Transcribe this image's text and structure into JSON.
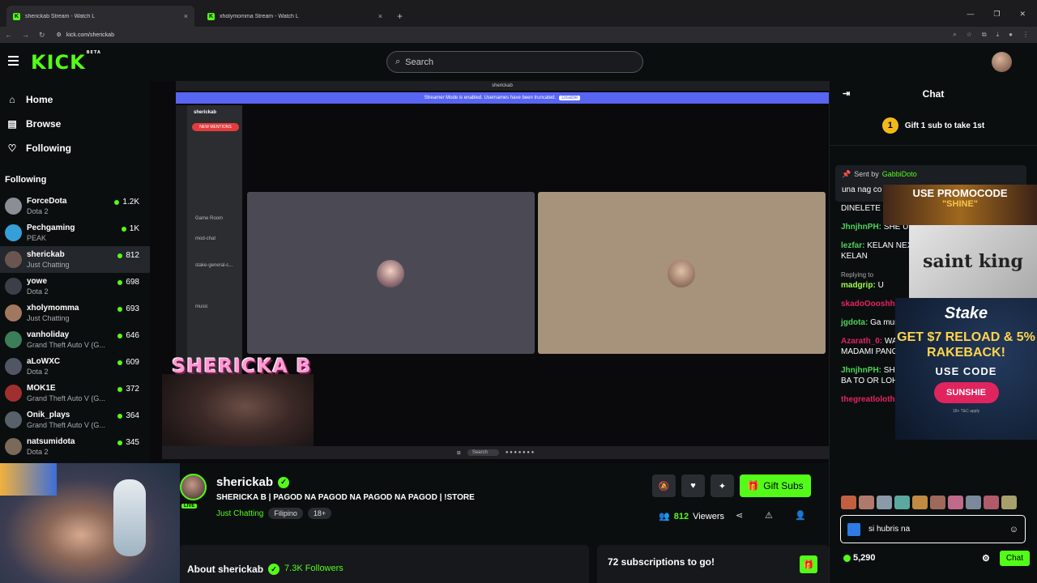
{
  "browser": {
    "tabs": [
      {
        "title": "sherickab Stream - Watch L",
        "active": true
      },
      {
        "title": "xholymomma Stream - Watch L",
        "active": false
      }
    ],
    "new_tab": "+",
    "url": "kick.com/sherickab"
  },
  "header": {
    "logo": "KICK",
    "logo_badge": "BETA",
    "search_placeholder": "Search"
  },
  "sidebar": {
    "nav": [
      {
        "label": "Home",
        "icon": "home-icon"
      },
      {
        "label": "Browse",
        "icon": "browse-icon"
      },
      {
        "label": "Following",
        "icon": "heart-icon"
      }
    ],
    "following_heading": "Following",
    "channels": [
      {
        "name": "ForceDota",
        "game": "Dota 2",
        "viewers": "1.2K",
        "color": "#8a8f96"
      },
      {
        "name": "Pechgaming",
        "game": "PEAK",
        "viewers": "1K",
        "color": "#35a0d8"
      },
      {
        "name": "sherickab",
        "game": "Just Chatting",
        "viewers": "812",
        "color": "#6b5550",
        "active": true
      },
      {
        "name": "yowe",
        "game": "Dota 2",
        "viewers": "698",
        "color": "#3a3f4a"
      },
      {
        "name": "xholymomma",
        "game": "Just Chatting",
        "viewers": "693",
        "color": "#a07860"
      },
      {
        "name": "vanholiday",
        "game": "Grand Theft Auto V (G...",
        "viewers": "646",
        "color": "#3a7e5a"
      },
      {
        "name": "aLoWXC",
        "game": "Dota 2",
        "viewers": "609",
        "color": "#505664"
      },
      {
        "name": "MOK1E",
        "game": "Grand Theft Auto V (G...",
        "viewers": "372",
        "color": "#a03030"
      },
      {
        "name": "Onik_plays",
        "game": "Grand Theft Auto V (G...",
        "viewers": "364",
        "color": "#58606a"
      },
      {
        "name": "natsumidota",
        "game": "Dota 2",
        "viewers": "345",
        "color": "#7a6a5a"
      }
    ]
  },
  "stream": {
    "discord_title": "sherickab",
    "streamer_mode": "Streamer Mode is enabled. Usernames have been truncated.",
    "disable_label": "Disable",
    "discord_server": "sherickab",
    "new_mentions": "NEW MENTIONS",
    "channels": [
      "Game Room",
      "mod-chat",
      "stake-general-c...",
      "music"
    ],
    "name_overlay": "SHERICKA B",
    "taskbar_search": "Search"
  },
  "channel": {
    "name": "sherickab",
    "live": "LIVE",
    "title": "SHERICKA B | PAGOD NA PAGOD NA PAGOD NA PAGOD | !STORE",
    "category": "Just Chatting",
    "tags": [
      "Filipino",
      "18+"
    ],
    "gift_subs_label": "Gift Subs",
    "viewers": "812",
    "viewers_label": "Viewers",
    "about_label": "About sherickab",
    "followers": "7.3K Followers",
    "subs_to_go": "72 subscriptions to go!"
  },
  "chat": {
    "title": "Chat",
    "gift_banner": "Gift 1 sub to take 1st",
    "gift_coin": "1",
    "pinned_by_prefix": "Sent by",
    "pinned_user": "GabbiDoto",
    "pinned_text": "una nag co",
    "messages": [
      {
        "user": "",
        "text": "DINELETE I DC SHE",
        "color": "#fff"
      },
      {
        "user": "JhnjhnPH:",
        "text": "SHE ULAN BA TO OR L",
        "color": "#4fd35b"
      },
      {
        "user": "lezfar:",
        "text": "KELAN NEX KELAN NEXT EP? NEXT EP? KELAN",
        "color": "#4fd35b"
      },
      {
        "reply": "Replying to ",
        "user": "madgrip:",
        "text": "U",
        "color": "#9cff4a"
      },
      {
        "user": "skadoOooshh",
        "text": "",
        "color": "#e0245e"
      },
      {
        "user": "jgdota:",
        "text": "Ga munggo, shes",
        "color": "#4fd35b"
      },
      {
        "user": "Azarath_0:",
        "text": "WA KAYO DALAWA MAGOVERTHI MADAMI PANG",
        "color": "#e0245e"
      },
      {
        "user": "JhnjhnPH:",
        "text": "SHE ANG LAKAS NG ULAN DITO, ULAN BA TO OR LOHA MO?",
        "color": "#4fd35b"
      },
      {
        "user": "thegreatlolothunderrr:",
        "text": "",
        "color": "#e0245e"
      }
    ],
    "ads": {
      "promo_title": "USE PROMOCODE",
      "promo_code": "\"SHINE\"",
      "saint_king": "saint king",
      "stake_brand": "Stake",
      "stake_offer": "GET $7 RELOAD & 5% RAKEBACK!",
      "stake_use": "USE CODE",
      "stake_code": "SUNSHIE",
      "stake_tc": "18+ T&C apply"
    },
    "input_value": "si hubris na",
    "points": "5,290",
    "send_label": "Chat"
  }
}
